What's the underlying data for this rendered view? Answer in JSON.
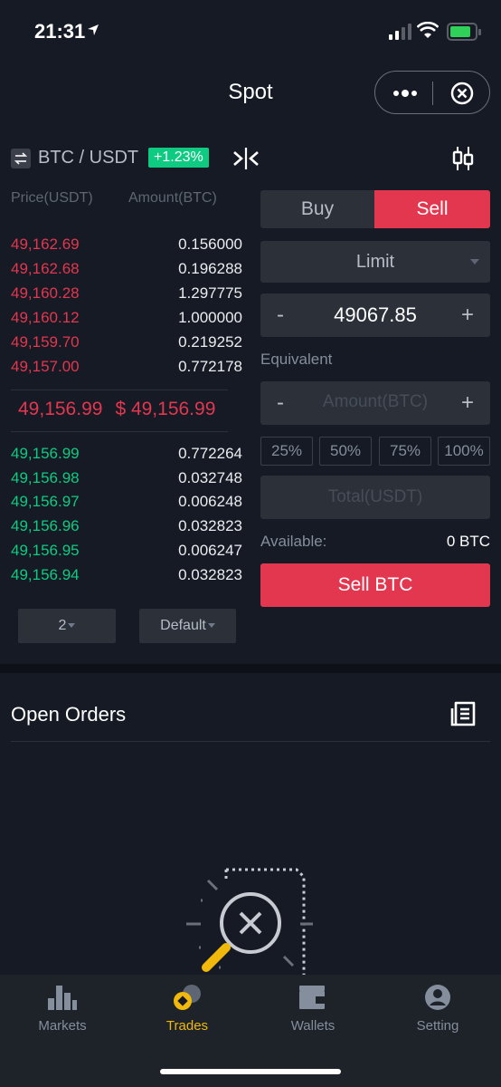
{
  "status_bar": {
    "time": "21:31"
  },
  "header": {
    "title": "Spot"
  },
  "pair": {
    "name": "BTC / USDT",
    "change": "+1.23%"
  },
  "order_book": {
    "price_header": "Price(USDT)",
    "amount_header": "Amount(BTC)",
    "asks": [
      {
        "price": "49,162.69",
        "amount": "0.156000"
      },
      {
        "price": "49,162.68",
        "amount": "0.196288"
      },
      {
        "price": "49,160.28",
        "amount": "1.297775"
      },
      {
        "price": "49,160.12",
        "amount": "1.000000"
      },
      {
        "price": "49,159.70",
        "amount": "0.219252"
      },
      {
        "price": "49,157.00",
        "amount": "0.772178"
      }
    ],
    "last_price": "49,156.99",
    "last_price_usd": "$ 49,156.99",
    "bids": [
      {
        "price": "49,156.99",
        "amount": "0.772264"
      },
      {
        "price": "49,156.98",
        "amount": "0.032748"
      },
      {
        "price": "49,156.97",
        "amount": "0.006248"
      },
      {
        "price": "49,156.96",
        "amount": "0.032823"
      },
      {
        "price": "49,156.95",
        "amount": "0.006247"
      },
      {
        "price": "49,156.94",
        "amount": "0.032823"
      }
    ],
    "precision_value": "2",
    "view_mode": "Default"
  },
  "order_form": {
    "buy_tab": "Buy",
    "sell_tab": "Sell",
    "order_type": "Limit",
    "minus": "-",
    "plus": "+",
    "price_value": "49067.85",
    "equivalent_label": "Equivalent",
    "amount_placeholder": "Amount(BTC)",
    "percentages": [
      "25%",
      "50%",
      "75%",
      "100%"
    ],
    "total_placeholder": "Total(USDT)",
    "available_label": "Available:",
    "available_value": "0 BTC",
    "submit_label": "Sell BTC"
  },
  "open_orders": {
    "title": "Open Orders"
  },
  "tab_bar": {
    "items": [
      {
        "label": "Markets",
        "icon": "bar-chart-icon"
      },
      {
        "label": "Trades",
        "icon": "coins-icon"
      },
      {
        "label": "Wallets",
        "icon": "wallet-icon"
      },
      {
        "label": "Setting",
        "icon": "user-icon"
      }
    ],
    "active": "Trades"
  },
  "colors": {
    "background": "#161a24",
    "sell_red": "#e2374f",
    "buy_green": "#0ecb81",
    "accent_yellow": "#f0b90b"
  }
}
